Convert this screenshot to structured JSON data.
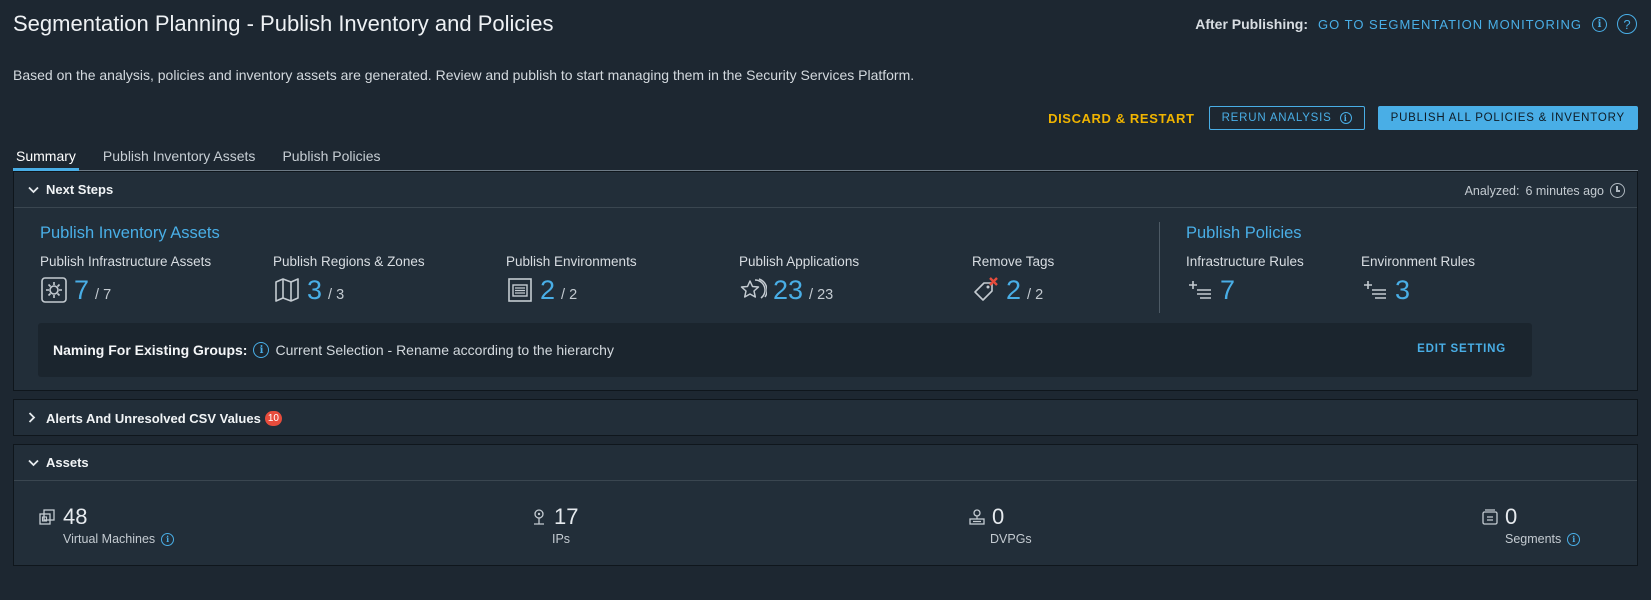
{
  "page": {
    "title": "Segmentation Planning - Publish Inventory and Policies",
    "description": "Based on the analysis, policies and inventory assets are generated. Review and publish to start managing them in the Security Services Platform."
  },
  "after_publishing": {
    "label": "After Publishing:",
    "link": "GO TO SEGMENTATION MONITORING"
  },
  "actions": {
    "discard": "DISCARD & RESTART",
    "rerun": "RERUN ANALYSIS",
    "publish_all": "PUBLISH ALL POLICIES & INVENTORY"
  },
  "tabs": [
    {
      "label": "Summary",
      "active": true
    },
    {
      "label": "Publish Inventory Assets",
      "active": false
    },
    {
      "label": "Publish Policies",
      "active": false
    }
  ],
  "next_steps": {
    "header": "Next Steps",
    "analyzed_label": "Analyzed:",
    "analyzed_value": "6 minutes ago",
    "inventory_title": "Publish Inventory Assets",
    "policies_title": "Publish Policies",
    "inventory_metrics": [
      {
        "label": "Publish Infrastructure Assets",
        "value": "7",
        "total": "/ 7",
        "icon": "gear-box-icon"
      },
      {
        "label": "Publish Regions & Zones",
        "value": "3",
        "total": "/ 3",
        "icon": "map-icon"
      },
      {
        "label": "Publish Environments",
        "value": "2",
        "total": "/ 2",
        "icon": "environment-icon"
      },
      {
        "label": "Publish Applications",
        "value": "23",
        "total": "/ 23",
        "icon": "applications-icon"
      },
      {
        "label": "Remove Tags",
        "value": "2",
        "total": "/ 2",
        "icon": "remove-tag-icon"
      }
    ],
    "policy_metrics": [
      {
        "label": "Infrastructure Rules",
        "value": "7",
        "icon": "add-rule-icon"
      },
      {
        "label": "Environment Rules",
        "value": "3",
        "icon": "add-rule-icon"
      }
    ],
    "naming": {
      "label": "Naming For Existing Groups:",
      "value": "Current Selection - Rename according to the hierarchy",
      "edit": "EDIT SETTING"
    }
  },
  "alerts": {
    "header": "Alerts And Unresolved CSV Values",
    "count": "10"
  },
  "assets": {
    "header": "Assets",
    "items": [
      {
        "value": "48",
        "label": "Virtual Machines",
        "icon": "vm-icon",
        "info": true
      },
      {
        "value": "17",
        "label": "IPs",
        "icon": "ip-icon",
        "info": false
      },
      {
        "value": "0",
        "label": "DVPGs",
        "icon": "dvpg-icon",
        "info": false
      },
      {
        "value": "0",
        "label": "Segments",
        "icon": "segment-icon",
        "info": true
      }
    ]
  },
  "colors": {
    "background": "#1d2731",
    "panel": "#222e39",
    "accent": "#49aee6",
    "warning": "#f0b400",
    "badge": "#e74c3c"
  }
}
